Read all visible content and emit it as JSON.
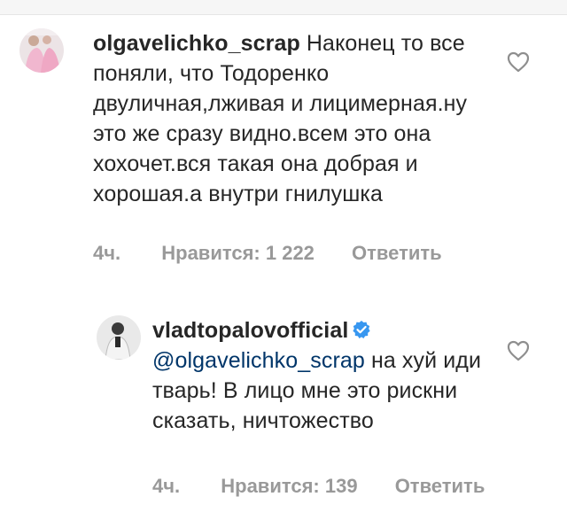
{
  "comments": [
    {
      "username": "olgavelichko_scrap",
      "text": "Наконец то все поняли, что  Тодоренко двуличная,лживая и лицимерная.ну это же сразу видно.всем это она хохочет.вся такая она добрая и хорошая.а внутри гнилушка",
      "time": "4ч.",
      "likes": "Нравится: 1 222",
      "reply_label": "Ответить"
    },
    {
      "username": "vladtopalovofficial",
      "mention": "@olgavelichko_scrap",
      "text": "на хуй иди тварь! В лицо мне это рискни сказать, ничтожество",
      "time": "4ч.",
      "likes": "Нравится: 139",
      "reply_label": "Ответить"
    }
  ],
  "icons": {
    "like": "heart-outline-icon",
    "verified": "verified-badge-icon"
  },
  "colors": {
    "verified": "#3897f0",
    "meta_text": "#999999",
    "mention": "#003569"
  }
}
